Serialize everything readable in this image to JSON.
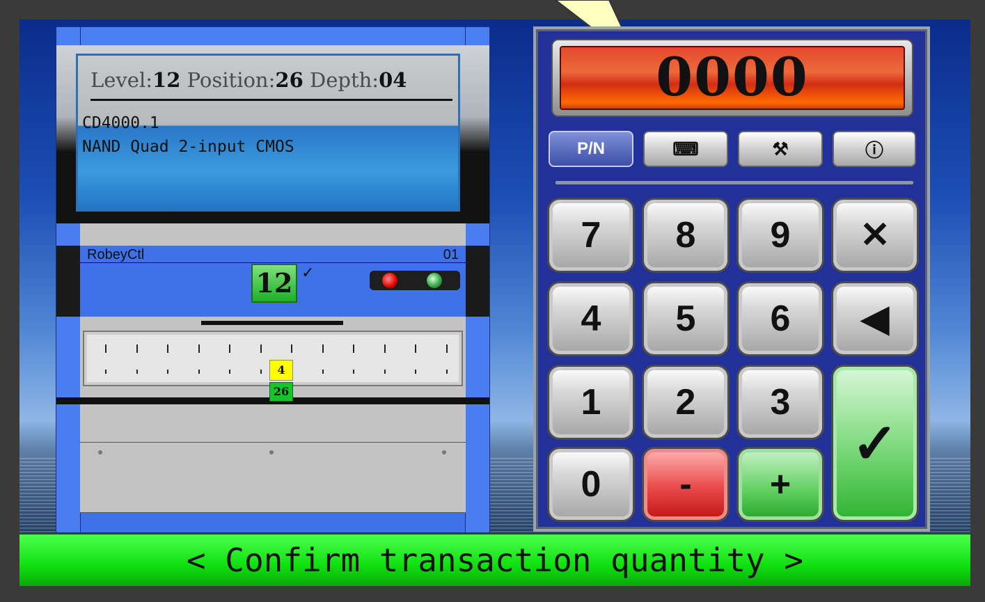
{
  "lcd": {
    "level_label": "Level:",
    "level_value": "12",
    "position_label": "Position:",
    "position_value": "26",
    "depth_label": "Depth:",
    "depth_value": "04",
    "part_number": "CD4000.1",
    "description": "NAND Quad 2-input CMOS"
  },
  "controller": {
    "name": "RobeyCtl",
    "id": "01",
    "level": "12",
    "level_check": "✓"
  },
  "shelf": {
    "depth_marker": "4",
    "position_marker": "26"
  },
  "keypad": {
    "display_value": "0000",
    "modes": [
      {
        "label": "P/N",
        "icon": "part-number",
        "active": true
      },
      {
        "label": "⌨",
        "icon": "keyboard-icon"
      },
      {
        "label": "⚒",
        "icon": "tools-icon"
      },
      {
        "label": "ⓘ",
        "icon": "info-icon"
      }
    ],
    "keys": {
      "k7": "7",
      "k8": "8",
      "k9": "9",
      "clear": "✕",
      "k4": "4",
      "k5": "5",
      "k6": "6",
      "back": "◀",
      "k1": "1",
      "k2": "2",
      "k3": "3",
      "enter": "✓",
      "k0": "0",
      "minus": "-",
      "plus": "+"
    }
  },
  "status": {
    "message": "< Confirm transaction quantity >"
  },
  "colors": {
    "status_bar": "#10e010",
    "display": "#e24a2e",
    "cabinet": "#3f72e8"
  }
}
